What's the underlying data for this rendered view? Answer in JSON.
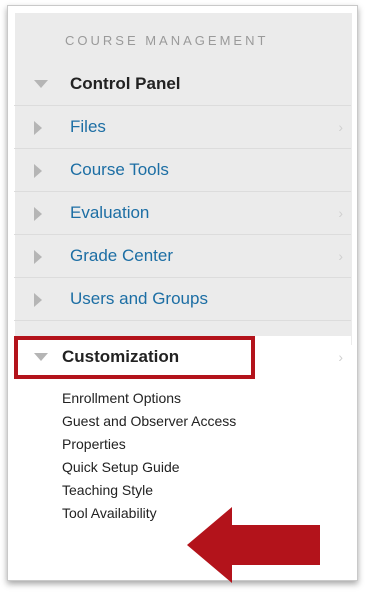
{
  "section": {
    "title": "COURSE MANAGEMENT"
  },
  "menu": {
    "items": [
      {
        "label": "Control Panel",
        "state": "expanded",
        "style": "bold"
      },
      {
        "label": "Files",
        "state": "collapsed",
        "style": "link"
      },
      {
        "label": "Course Tools",
        "state": "collapsed",
        "style": "link"
      },
      {
        "label": "Evaluation",
        "state": "collapsed",
        "style": "link"
      },
      {
        "label": "Grade Center",
        "state": "collapsed",
        "style": "link"
      },
      {
        "label": "Users and Groups",
        "state": "collapsed",
        "style": "link"
      },
      {
        "label": "Customization",
        "state": "expanded",
        "style": "bold"
      }
    ],
    "chevron": "›"
  },
  "customization": {
    "links": [
      "Enrollment Options",
      "Guest and Observer Access",
      "Properties",
      "Quick Setup Guide",
      "Teaching Style",
      "Tool Availability"
    ]
  },
  "colors": {
    "highlight": "#b3131b",
    "link": "#1c6ea4",
    "menu_bg": "#ebebeb"
  },
  "icons": {
    "expanded": "triangle-down-icon",
    "collapsed": "triangle-right-icon",
    "pointer": "red-arrow-icon"
  }
}
